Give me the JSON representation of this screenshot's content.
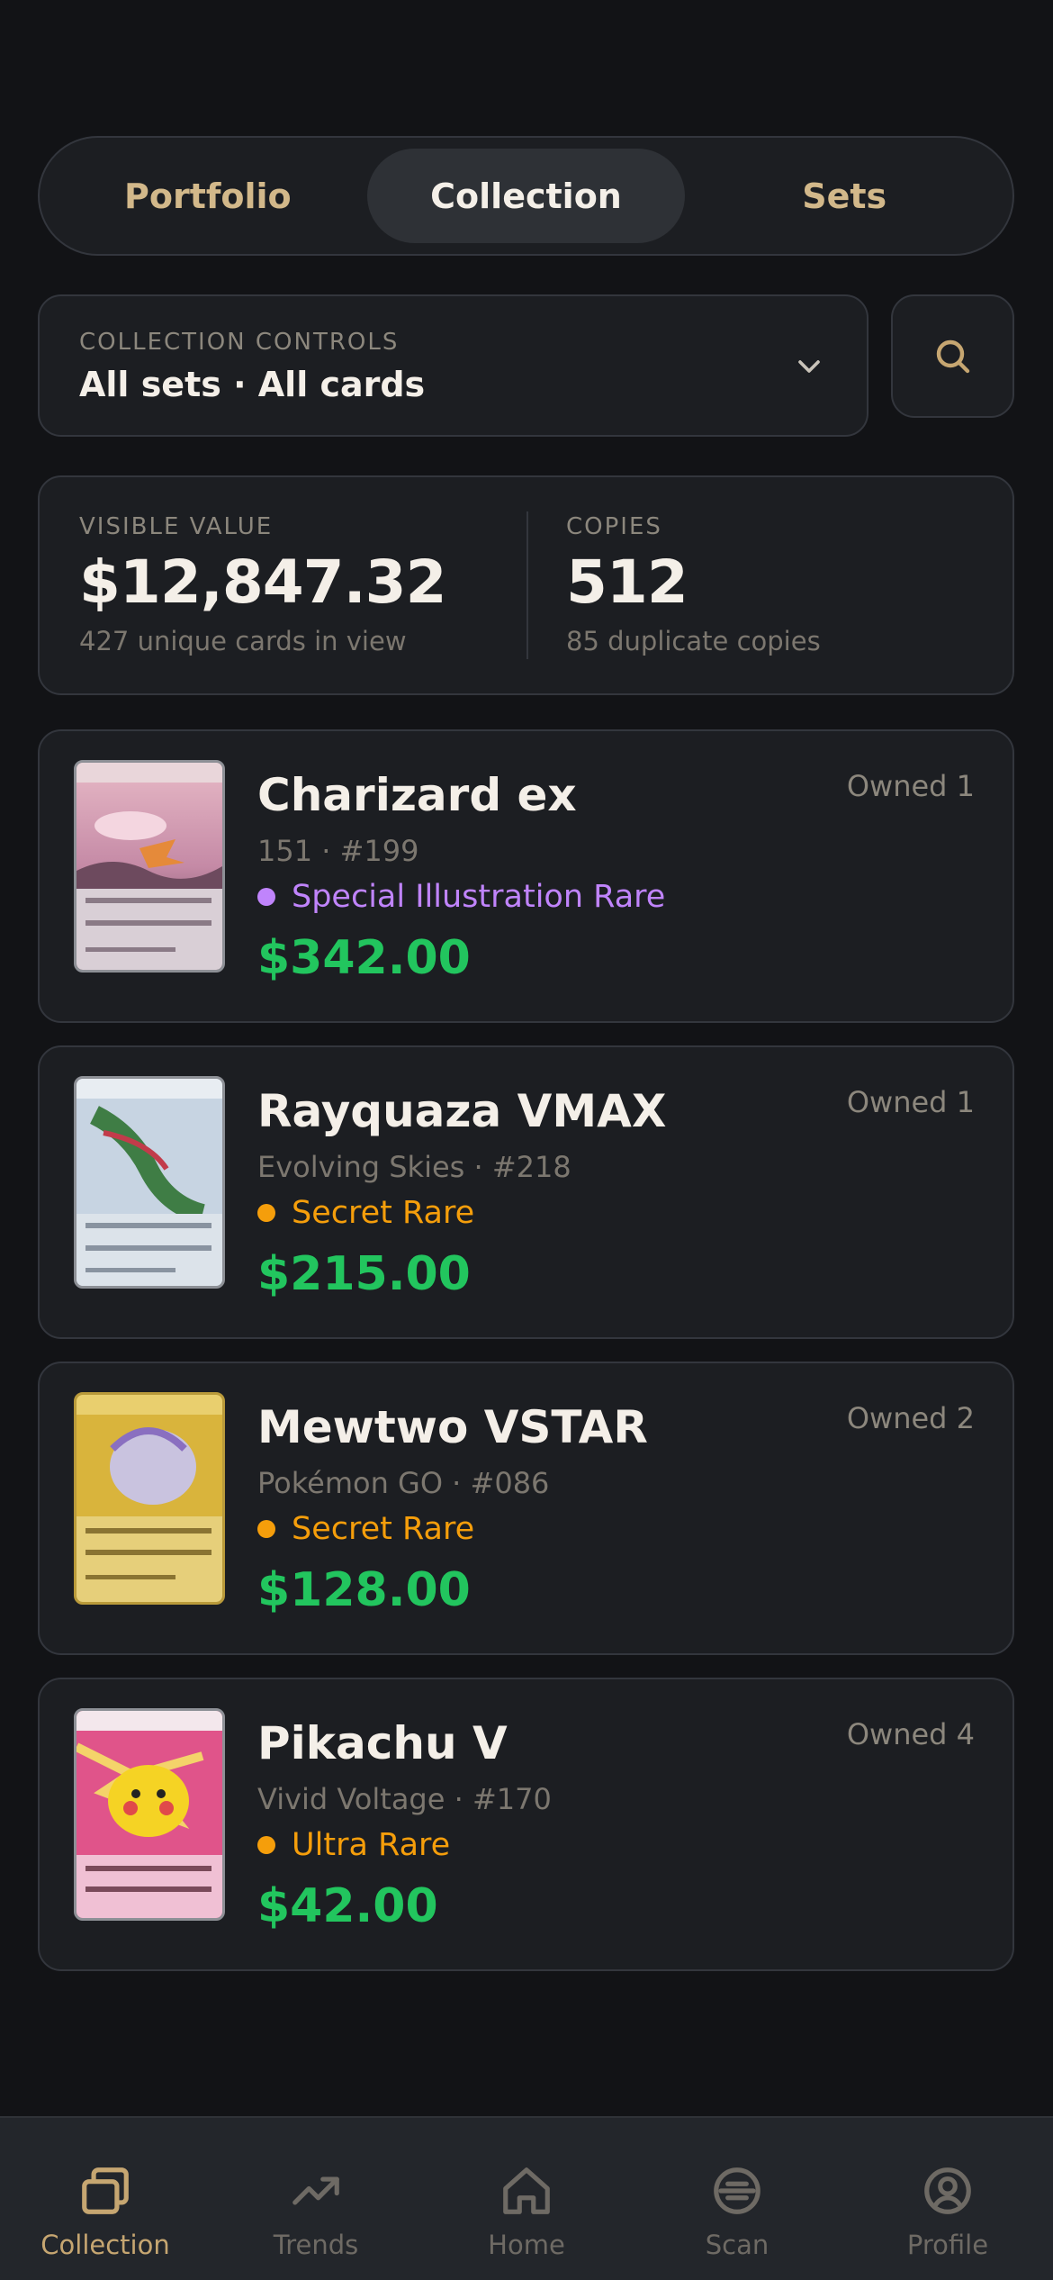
{
  "segments": [
    "Portfolio",
    "Collection",
    "Sets"
  ],
  "controls": {
    "label": "COLLECTION CONTROLS",
    "value": "All sets · All cards",
    "icon": "chevron-down-icon",
    "search_icon": "search-icon"
  },
  "stats": {
    "value_label": "VISIBLE VALUE",
    "value": "$12,847.32",
    "value_sub": "427 unique cards in view",
    "copies_label": "COPIES",
    "copies": "512",
    "copies_sub": "85 duplicate copies"
  },
  "cards": [
    {
      "name": "Charizard ex",
      "set": "151 · #199",
      "rarity": "Special Illustration Rare",
      "rarity_color": "#c084fc",
      "price": "$342.00",
      "owned": "Owned 1"
    },
    {
      "name": "Rayquaza VMAX",
      "set": "Evolving Skies · #218",
      "rarity": "Secret Rare",
      "rarity_color": "#f59e0b",
      "price": "$215.00",
      "owned": "Owned 1"
    },
    {
      "name": "Mewtwo VSTAR",
      "set": "Pokémon GO · #086",
      "rarity": "Secret Rare",
      "rarity_color": "#f59e0b",
      "price": "$128.00",
      "owned": "Owned 2"
    },
    {
      "name": "Pikachu V",
      "set": "Vivid Voltage · #170",
      "rarity": "Ultra Rare",
      "rarity_color": "#f59e0b",
      "price": "$42.00",
      "owned": "Owned 4"
    }
  ],
  "tabs": [
    {
      "label": "Collection",
      "icon": "cards-icon",
      "active": true
    },
    {
      "label": "Trends",
      "icon": "trend-up-icon",
      "active": false
    },
    {
      "label": "Home",
      "icon": "home-icon",
      "active": false
    },
    {
      "label": "Scan",
      "icon": "scan-icon",
      "active": false
    },
    {
      "label": "Profile",
      "icon": "profile-icon",
      "active": false
    }
  ],
  "colors": {
    "accent": "#c6a671",
    "price": "#22c55e",
    "background": "#121316",
    "surface": "#1c1e22"
  }
}
